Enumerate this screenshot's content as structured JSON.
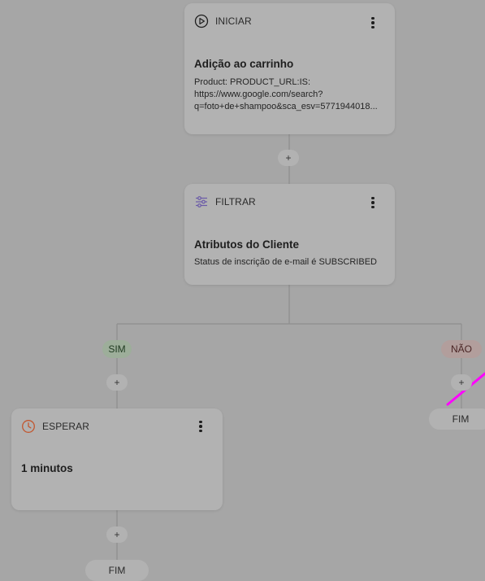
{
  "nodes": {
    "start": {
      "type_label": "INICIAR",
      "title": "Adição ao carrinho",
      "lines": [
        "Product: PRODUCT_URL:IS:",
        "https://www.google.com/search?",
        "q=foto+de+shampoo&sca_esv=5771944018..."
      ]
    },
    "filter": {
      "type_label": "FILTRAR",
      "title": "Atributos do Cliente",
      "line": "Status de inscrição de e-mail é SUBSCRIBED"
    },
    "wait": {
      "type_label": "ESPERAR",
      "title": "1 minutos"
    }
  },
  "branches": {
    "yes": "SIM",
    "no": "NÃO"
  },
  "plus_label": "+",
  "end_label": "FIM",
  "colors": {
    "overlay_bg": "#a6a6a6",
    "card_bg": "#b2b2b2",
    "wait_icon": "#c2572f",
    "yes_badge": "#9dae9a",
    "no_badge": "#b29e9c",
    "annotation_line": "#ff00ff"
  }
}
